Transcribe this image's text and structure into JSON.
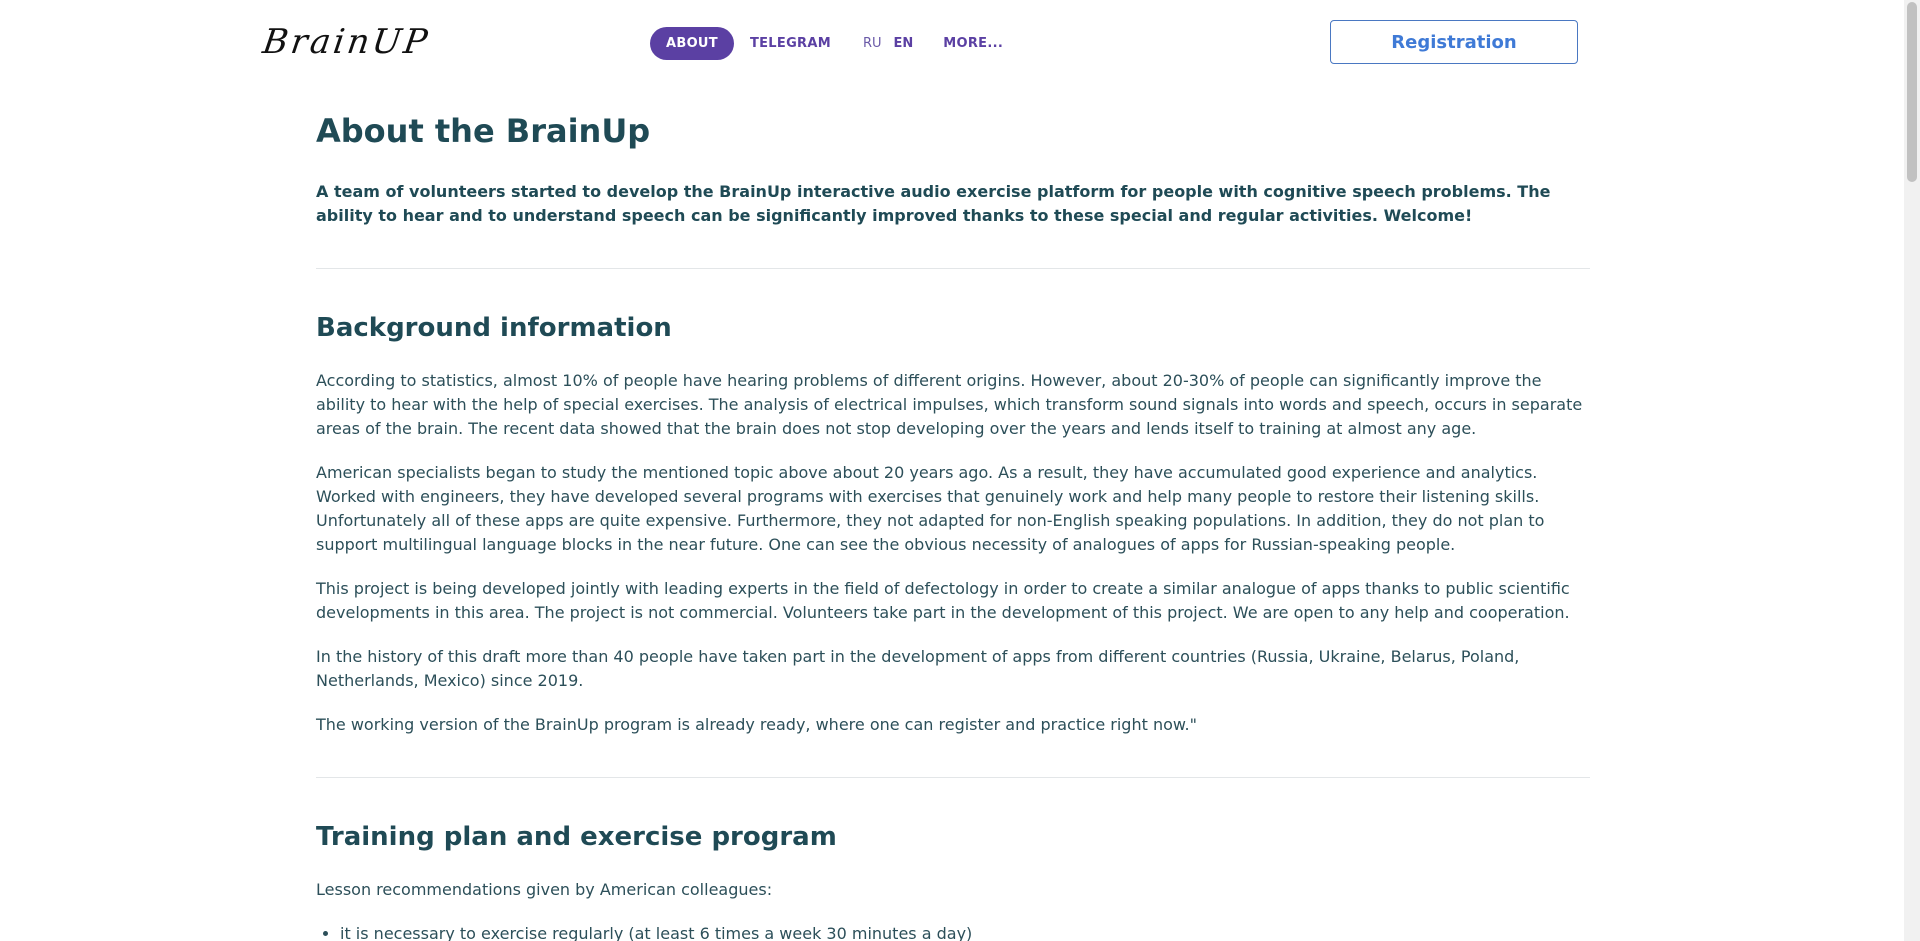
{
  "header": {
    "logo_text": "BrainUP",
    "nav": {
      "about": "ABOUT",
      "telegram": "TELEGRAM",
      "lang_ru": "RU",
      "lang_en": "EN",
      "more": "MORE..."
    },
    "registration_label": "Registration"
  },
  "main": {
    "title": "About the BrainUp",
    "lead": "A team of volunteers started to develop the BrainUp interactive audio exercise platform for people with cognitive speech problems. The ability to hear and to understand speech can be significantly improved thanks to these special and regular activities. Welcome!",
    "background": {
      "heading": "Background information",
      "paragraphs": [
        "According to statistics, almost 10% of people have hearing problems of different origins. However, about 20-30% of people can significantly improve the ability to hear with the help of special exercises. The analysis of electrical impulses, which transform sound signals into words and speech, occurs in separate areas of the brain. The recent data showed that the brain does not stop developing over the years and lends itself to training at almost any age.",
        "American specialists began to study the mentioned topic above about 20 years ago. As a result, they have accumulated good experience and analytics. Worked with engineers, they have developed several programs with exercises that genuinely work and help many people to restore their listening skills. Unfortunately all of these apps are quite expensive. Furthermore, they not adapted for non-English speaking populations. In addition, they do not plan to support multilingual language blocks in the near future. One can see the obvious necessity of analogues of apps for Russian-speaking people.",
        "This project is being developed jointly with leading experts in the field of defectology in order to create a similar analogue of apps thanks to public scientific developments in this area. The project is not commercial. Volunteers take part in the development of this project. We are open to any help and cooperation.",
        "In the history of this draft more than 40 people have taken part in the development of apps from different countries (Russia, Ukraine, Belarus, Poland, Netherlands, Mexico) since 2019.",
        "The working version of the BrainUp program is already ready, where one can register and practice right now.\""
      ]
    },
    "training": {
      "heading": "Training plan and exercise program",
      "intro": "Lesson recommendations given by American colleagues:",
      "bullets": [
        "it is necessary to exercise regularly (at least 6 times a week 30 minutes a day)"
      ]
    }
  }
}
